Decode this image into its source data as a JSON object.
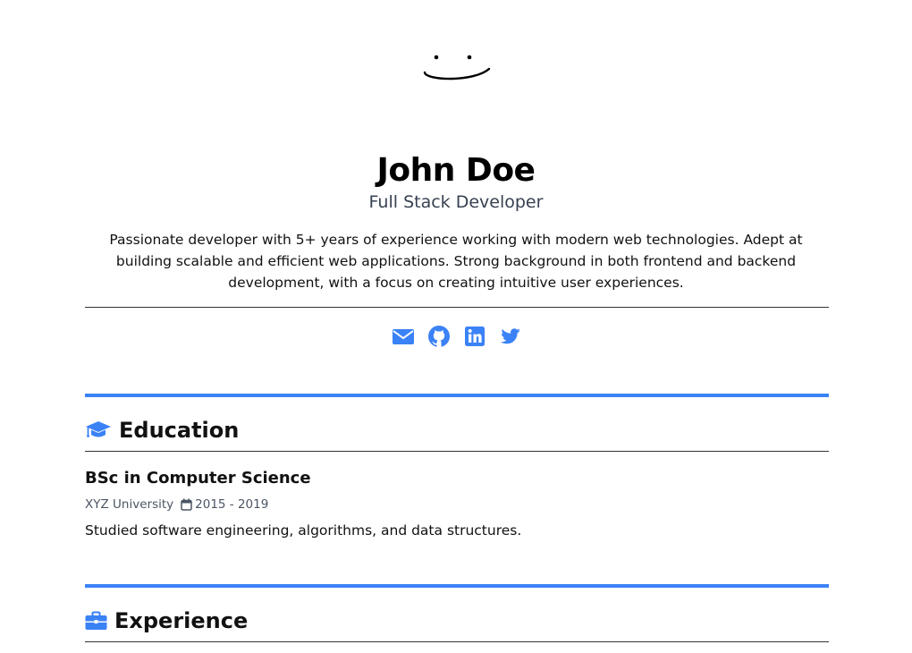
{
  "profile": {
    "name": "John Doe",
    "role": "Full Stack Developer",
    "bio": "Passionate developer with 5+ years of experience working with modern web technologies. Adept at building scalable and efficient web applications. Strong background in both frontend and backend development, with a focus on creating intuitive user experiences."
  },
  "socials": [
    {
      "icon": "envelope-icon"
    },
    {
      "icon": "github-icon"
    },
    {
      "icon": "linkedin-icon"
    },
    {
      "icon": "twitter-icon"
    }
  ],
  "colors": {
    "accent": "#3b82f6",
    "muted": "#4b5563"
  },
  "education": {
    "title": "Education",
    "icon": "graduation-cap-icon",
    "entries": [
      {
        "degree": "BSc in Computer Science",
        "school": "XYZ University",
        "dates": "2015 - 2019",
        "description": "Studied software engineering, algorithms, and data structures."
      }
    ]
  },
  "experience": {
    "title": "Experience",
    "icon": "briefcase-icon"
  }
}
